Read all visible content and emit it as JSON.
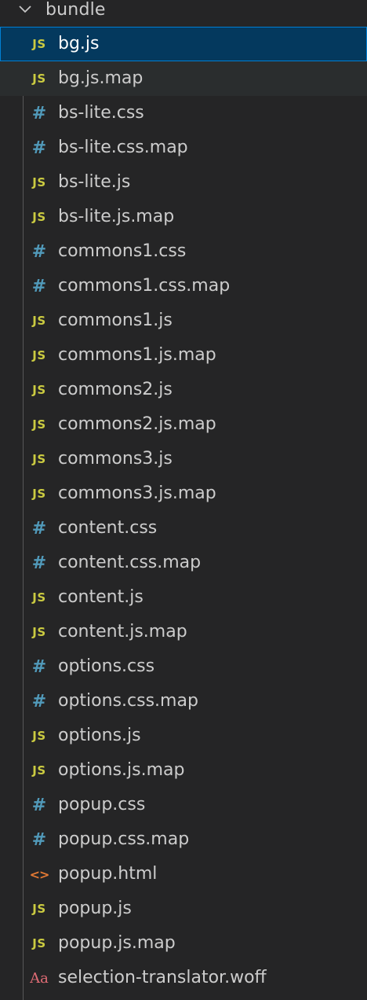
{
  "folder": {
    "name": "bundle",
    "expanded": true
  },
  "colors": {
    "background": "#252526",
    "selected_background": "#04395e",
    "selected_border": "#007fd4",
    "text": "#cccccc",
    "js_icon": "#cbcb41",
    "css_icon": "#519aba",
    "html_icon": "#e37933",
    "font_icon": "#e06c75"
  },
  "files": [
    {
      "name": "bg.js",
      "icon": "js-icon",
      "glyph": "JS",
      "selected": true
    },
    {
      "name": "bg.js.map",
      "icon": "js-icon",
      "glyph": "JS",
      "hover": true
    },
    {
      "name": "bs-lite.css",
      "icon": "css-hash-icon",
      "glyph": "#"
    },
    {
      "name": "bs-lite.css.map",
      "icon": "css-hash-icon",
      "glyph": "#"
    },
    {
      "name": "bs-lite.js",
      "icon": "js-icon",
      "glyph": "JS"
    },
    {
      "name": "bs-lite.js.map",
      "icon": "js-icon",
      "glyph": "JS"
    },
    {
      "name": "commons1.css",
      "icon": "css-hash-icon",
      "glyph": "#"
    },
    {
      "name": "commons1.css.map",
      "icon": "css-hash-icon",
      "glyph": "#"
    },
    {
      "name": "commons1.js",
      "icon": "js-icon",
      "glyph": "JS"
    },
    {
      "name": "commons1.js.map",
      "icon": "js-icon",
      "glyph": "JS"
    },
    {
      "name": "commons2.js",
      "icon": "js-icon",
      "glyph": "JS"
    },
    {
      "name": "commons2.js.map",
      "icon": "js-icon",
      "glyph": "JS"
    },
    {
      "name": "commons3.js",
      "icon": "js-icon",
      "glyph": "JS"
    },
    {
      "name": "commons3.js.map",
      "icon": "js-icon",
      "glyph": "JS"
    },
    {
      "name": "content.css",
      "icon": "css-hash-icon",
      "glyph": "#"
    },
    {
      "name": "content.css.map",
      "icon": "css-hash-icon",
      "glyph": "#"
    },
    {
      "name": "content.js",
      "icon": "js-icon",
      "glyph": "JS"
    },
    {
      "name": "content.js.map",
      "icon": "js-icon",
      "glyph": "JS"
    },
    {
      "name": "options.css",
      "icon": "css-hash-icon",
      "glyph": "#"
    },
    {
      "name": "options.css.map",
      "icon": "css-hash-icon",
      "glyph": "#"
    },
    {
      "name": "options.js",
      "icon": "js-icon",
      "glyph": "JS"
    },
    {
      "name": "options.js.map",
      "icon": "js-icon",
      "glyph": "JS"
    },
    {
      "name": "popup.css",
      "icon": "css-hash-icon",
      "glyph": "#"
    },
    {
      "name": "popup.css.map",
      "icon": "css-hash-icon",
      "glyph": "#"
    },
    {
      "name": "popup.html",
      "icon": "html-code-icon",
      "glyph": "<>"
    },
    {
      "name": "popup.js",
      "icon": "js-icon",
      "glyph": "JS"
    },
    {
      "name": "popup.js.map",
      "icon": "js-icon",
      "glyph": "JS"
    },
    {
      "name": "selection-translator.woff",
      "icon": "font-file-icon",
      "glyph": "Aa"
    }
  ]
}
